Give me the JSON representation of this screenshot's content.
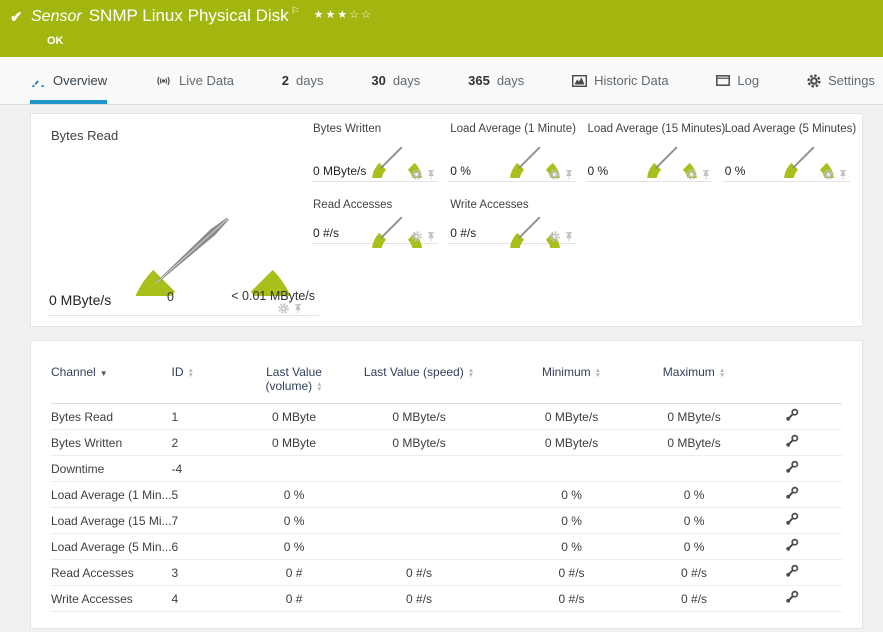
{
  "header": {
    "check_icon": "✔",
    "kind": "Sensor",
    "title": "SNMP Linux Physical Disk",
    "flag_icon": "⚐",
    "stars": "★★★☆☆",
    "status": "OK"
  },
  "tabs": [
    {
      "label": "Overview"
    },
    {
      "label": "Live Data"
    },
    {
      "number": "2",
      "label": "days"
    },
    {
      "number": "30",
      "label": "days"
    },
    {
      "number": "365",
      "label": "days"
    },
    {
      "label": "Historic Data"
    },
    {
      "label": "Log"
    },
    {
      "label": "Settings"
    }
  ],
  "gauges": {
    "primary": {
      "label": "Bytes Read",
      "value": "0 MByte/s",
      "scale_min": "0",
      "scale_max": "< 0.01 MByte/s"
    },
    "small": [
      {
        "label": "Bytes Written",
        "value": "0 MByte/s"
      },
      {
        "label": "Load Average (1 Minute)",
        "value": "0 %"
      },
      {
        "label": "Load Average (15 Minutes)",
        "value": "0 %"
      },
      {
        "label": "Load Average (5 Minutes)",
        "value": "0 %"
      },
      {
        "label": "Read Accesses",
        "value": "0 #/s"
      },
      {
        "label": "Write Accesses",
        "value": "0 #/s"
      }
    ]
  },
  "table": {
    "columns": {
      "channel": "Channel",
      "id": "ID",
      "volume": "Last Value (volume)",
      "speed": "Last Value (speed)",
      "min": "Minimum",
      "max": "Maximum"
    },
    "rows": [
      {
        "channel": "Bytes Read",
        "id": "1",
        "volume": "0 MByte",
        "speed": "0 MByte/s",
        "min": "0 MByte/s",
        "max": "0 MByte/s"
      },
      {
        "channel": "Bytes Written",
        "id": "2",
        "volume": "0 MByte",
        "speed": "0 MByte/s",
        "min": "0 MByte/s",
        "max": "0 MByte/s"
      },
      {
        "channel": "Downtime",
        "id": "-4",
        "volume": "",
        "speed": "",
        "min": "",
        "max": ""
      },
      {
        "channel": "Load Average (1 Min...",
        "id": "5",
        "volume": "0 %",
        "speed": "",
        "min": "0 %",
        "max": "0 %"
      },
      {
        "channel": "Load Average (15 Mi...",
        "id": "7",
        "volume": "0 %",
        "speed": "",
        "min": "0 %",
        "max": "0 %"
      },
      {
        "channel": "Load Average (5 Min...",
        "id": "6",
        "volume": "0 %",
        "speed": "",
        "min": "0 %",
        "max": "0 %"
      },
      {
        "channel": "Read Accesses",
        "id": "3",
        "volume": "0 #",
        "speed": "0 #/s",
        "min": "0 #/s",
        "max": "0 #/s"
      },
      {
        "channel": "Write Accesses",
        "id": "4",
        "volume": "0 #",
        "speed": "0 #/s",
        "min": "0 #/s",
        "max": "0 #/s"
      }
    ]
  },
  "colors": {
    "status_green": "#a2b60f",
    "gauge_green": "#a8c019",
    "accent_blue": "#1d96c9"
  }
}
